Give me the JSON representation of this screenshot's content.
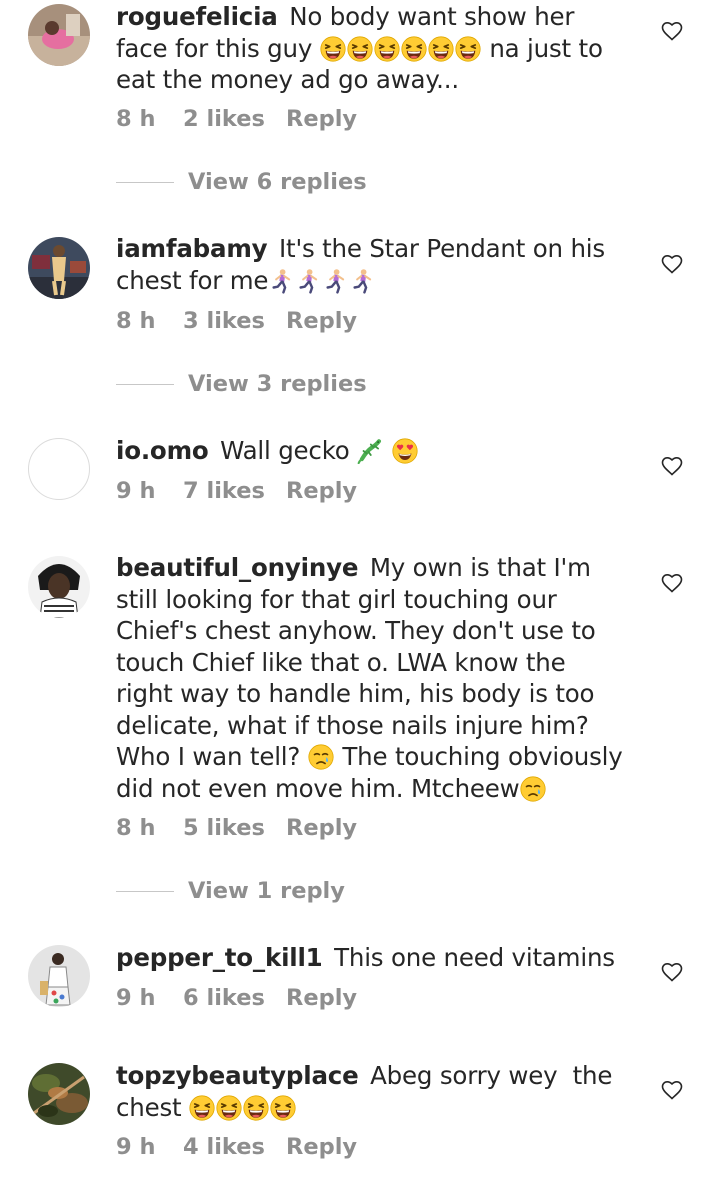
{
  "icons": {
    "like": "heart-outline-icon",
    "emoji_laugh": "grinning-squinting-face",
    "emoji_run": "woman-running",
    "emoji_lizard": "lizard",
    "emoji_heart_eyes": "smiling-face-with-heart-eyes",
    "emoji_cry": "crying-face"
  },
  "colors": {
    "text": "#262626",
    "secondary": "#8e8e8e",
    "divider": "#c7c7c7"
  },
  "comments": [
    {
      "username": "roguefelicia",
      "text_before": "No body want show her face for this guy",
      "text_after": "na just to eat the money ad go away...",
      "time": "8 h",
      "likes": "2 likes",
      "reply": "Reply",
      "view_replies": "View 6 replies"
    },
    {
      "username": "iamfabamy",
      "text_before": "It's the Star Pendant on his chest for me",
      "time": "8 h",
      "likes": "3 likes",
      "reply": "Reply",
      "view_replies": "View 3 replies"
    },
    {
      "username": "io.omo",
      "text_before": "Wall gecko",
      "time": "9 h",
      "likes": "7 likes",
      "reply": "Reply"
    },
    {
      "username": "beautiful_onyinye",
      "text_before": "My own is that I'm still looking for that girl touching our Chief's chest anyhow. They don't use to touch Chief like that o. LWA know the right way to handle him, his body is too delicate, what if those nails injure him? Who I wan tell?",
      "text_after": "The touching obviously did not even move him. Mtcheew",
      "time": "8 h",
      "likes": "5 likes",
      "reply": "Reply",
      "view_replies": "View 1 reply"
    },
    {
      "username": "pepper_to_kill1",
      "text_before": "This one need vitamins",
      "time": "9 h",
      "likes": "6 likes",
      "reply": "Reply"
    },
    {
      "username": "topzybeautyplace",
      "text_before": "Abeg sorry wey  the chest",
      "time": "9 h",
      "likes": "4 likes",
      "reply": "Reply"
    }
  ]
}
